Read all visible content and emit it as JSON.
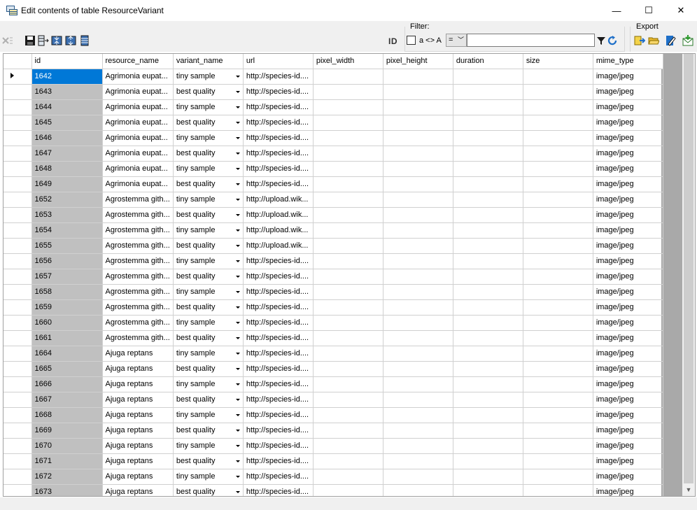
{
  "window": {
    "title": "Edit contents of table ResourceVariant",
    "minimize": "—",
    "maximize": "☐",
    "close": "✕"
  },
  "toolbar": {
    "filter_label": "Filter:",
    "export_label": "Export",
    "id_label": "ID",
    "case_label": "a <> A",
    "operator": "=",
    "filter_value": ""
  },
  "grid": {
    "columns": [
      "id",
      "resource_name",
      "variant_name",
      "url",
      "pixel_width",
      "pixel_height",
      "duration",
      "size",
      "mime_type"
    ],
    "rows": [
      [
        "1642",
        "Agrimonia eupat...",
        "tiny sample",
        "http://species-id....",
        "",
        "",
        "",
        "",
        "image/jpeg"
      ],
      [
        "1643",
        "Agrimonia eupat...",
        "best quality",
        "http://species-id....",
        "",
        "",
        "",
        "",
        "image/jpeg"
      ],
      [
        "1644",
        "Agrimonia eupat...",
        "tiny sample",
        "http://species-id....",
        "",
        "",
        "",
        "",
        "image/jpeg"
      ],
      [
        "1645",
        "Agrimonia eupat...",
        "best quality",
        "http://species-id....",
        "",
        "",
        "",
        "",
        "image/jpeg"
      ],
      [
        "1646",
        "Agrimonia eupat...",
        "tiny sample",
        "http://species-id....",
        "",
        "",
        "",
        "",
        "image/jpeg"
      ],
      [
        "1647",
        "Agrimonia eupat...",
        "best quality",
        "http://species-id....",
        "",
        "",
        "",
        "",
        "image/jpeg"
      ],
      [
        "1648",
        "Agrimonia eupat...",
        "tiny sample",
        "http://species-id....",
        "",
        "",
        "",
        "",
        "image/jpeg"
      ],
      [
        "1649",
        "Agrimonia eupat...",
        "best quality",
        "http://species-id....",
        "",
        "",
        "",
        "",
        "image/jpeg"
      ],
      [
        "1652",
        "Agrostemma gith...",
        "tiny sample",
        "http://upload.wik...",
        "",
        "",
        "",
        "",
        "image/jpeg"
      ],
      [
        "1653",
        "Agrostemma gith...",
        "best quality",
        "http://upload.wik...",
        "",
        "",
        "",
        "",
        "image/jpeg"
      ],
      [
        "1654",
        "Agrostemma gith...",
        "tiny sample",
        "http://upload.wik...",
        "",
        "",
        "",
        "",
        "image/jpeg"
      ],
      [
        "1655",
        "Agrostemma gith...",
        "best quality",
        "http://upload.wik...",
        "",
        "",
        "",
        "",
        "image/jpeg"
      ],
      [
        "1656",
        "Agrostemma gith...",
        "tiny sample",
        "http://species-id....",
        "",
        "",
        "",
        "",
        "image/jpeg"
      ],
      [
        "1657",
        "Agrostemma gith...",
        "best quality",
        "http://species-id....",
        "",
        "",
        "",
        "",
        "image/jpeg"
      ],
      [
        "1658",
        "Agrostemma gith...",
        "tiny sample",
        "http://species-id....",
        "",
        "",
        "",
        "",
        "image/jpeg"
      ],
      [
        "1659",
        "Agrostemma gith...",
        "best quality",
        "http://species-id....",
        "",
        "",
        "",
        "",
        "image/jpeg"
      ],
      [
        "1660",
        "Agrostemma gith...",
        "tiny sample",
        "http://species-id....",
        "",
        "",
        "",
        "",
        "image/jpeg"
      ],
      [
        "1661",
        "Agrostemma gith...",
        "best quality",
        "http://species-id....",
        "",
        "",
        "",
        "",
        "image/jpeg"
      ],
      [
        "1664",
        "Ajuga reptans",
        "tiny sample",
        "http://species-id....",
        "",
        "",
        "",
        "",
        "image/jpeg"
      ],
      [
        "1665",
        "Ajuga reptans",
        "best quality",
        "http://species-id....",
        "",
        "",
        "",
        "",
        "image/jpeg"
      ],
      [
        "1666",
        "Ajuga reptans",
        "tiny sample",
        "http://species-id....",
        "",
        "",
        "",
        "",
        "image/jpeg"
      ],
      [
        "1667",
        "Ajuga reptans",
        "best quality",
        "http://species-id....",
        "",
        "",
        "",
        "",
        "image/jpeg"
      ],
      [
        "1668",
        "Ajuga reptans",
        "tiny sample",
        "http://species-id....",
        "",
        "",
        "",
        "",
        "image/jpeg"
      ],
      [
        "1669",
        "Ajuga reptans",
        "best quality",
        "http://species-id....",
        "",
        "",
        "",
        "",
        "image/jpeg"
      ],
      [
        "1670",
        "Ajuga reptans",
        "tiny sample",
        "http://species-id....",
        "",
        "",
        "",
        "",
        "image/jpeg"
      ],
      [
        "1671",
        "Ajuga reptans",
        "best quality",
        "http://species-id....",
        "",
        "",
        "",
        "",
        "image/jpeg"
      ],
      [
        "1672",
        "Ajuga reptans",
        "tiny sample",
        "http://species-id....",
        "",
        "",
        "",
        "",
        "image/jpeg"
      ],
      [
        "1673",
        "Ajuga reptans",
        "best quality",
        "http://species-id....",
        "",
        "",
        "",
        "",
        "image/jpeg"
      ]
    ]
  },
  "colors": {
    "selection": "#0078d7",
    "id_column_bg": "#c0c0c0",
    "chrome_bg": "#f0f0f0"
  }
}
